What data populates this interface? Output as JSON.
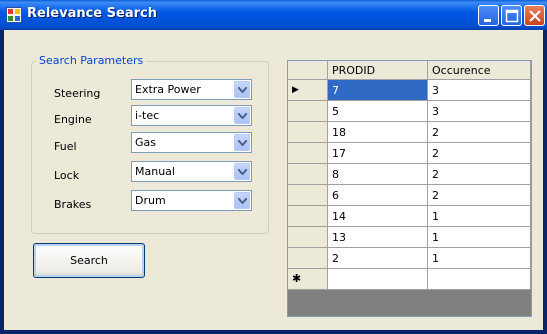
{
  "window": {
    "title": "Relevance Search"
  },
  "search_params": {
    "group_title": "Search Parameters",
    "fields": [
      {
        "label": "Steering",
        "value": "Extra Power"
      },
      {
        "label": "Engine",
        "value": "i-tec"
      },
      {
        "label": "Fuel",
        "value": "Gas"
      },
      {
        "label": "Lock",
        "value": "Manual"
      },
      {
        "label": "Brakes",
        "value": "Drum"
      }
    ]
  },
  "search_button": {
    "label": "Search"
  },
  "results": {
    "columns": [
      "PRODID",
      "Occurence"
    ],
    "rows": [
      [
        "7",
        "3"
      ],
      [
        "5",
        "3"
      ],
      [
        "18",
        "2"
      ],
      [
        "17",
        "2"
      ],
      [
        "8",
        "2"
      ],
      [
        "6",
        "2"
      ],
      [
        "14",
        "1"
      ],
      [
        "13",
        "1"
      ],
      [
        "2",
        "1"
      ]
    ],
    "current_row_marker": "▶",
    "new_row_marker": "✱"
  },
  "colors": {
    "title_bar": "#0054E3",
    "group_title": "#0046D5",
    "selection": "#316AC5"
  }
}
